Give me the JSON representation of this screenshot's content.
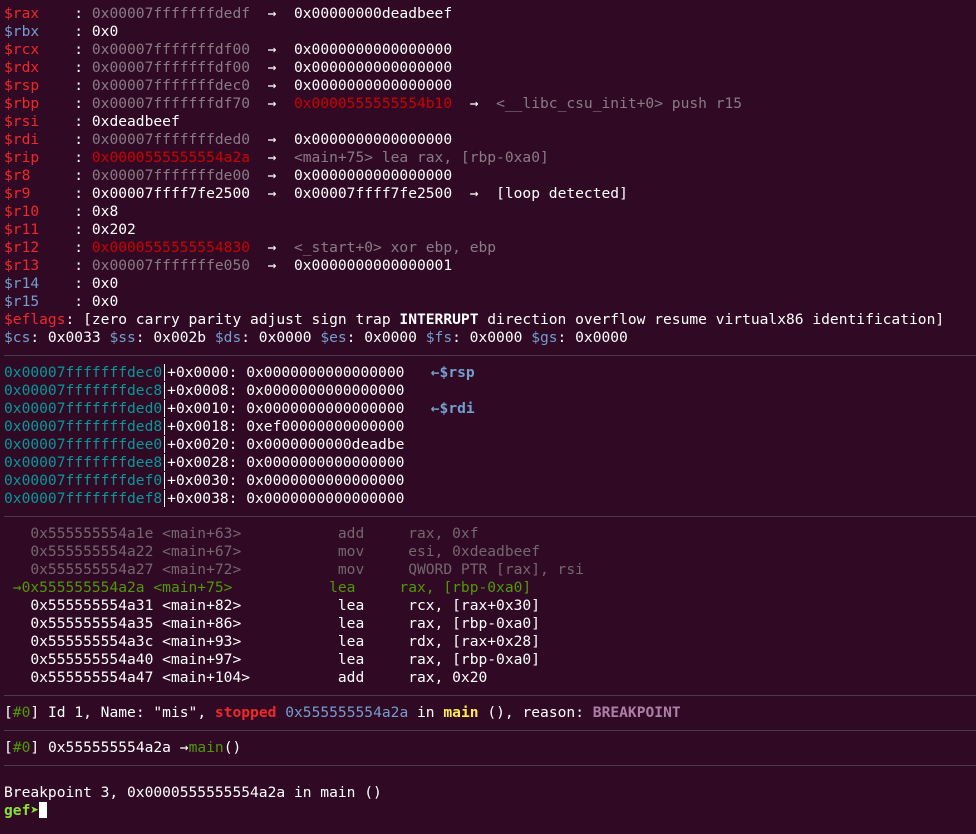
{
  "registers": [
    {
      "name": "$rax",
      "nc": "red",
      "val": "0x00007fffffffdedf",
      "vc": "gray",
      "chain": [
        {
          "t": "0x00000000deadbeef",
          "c": "white"
        }
      ]
    },
    {
      "name": "$rbx",
      "nc": "blue",
      "val": "0x0",
      "vc": "white",
      "chain": []
    },
    {
      "name": "$rcx",
      "nc": "red",
      "val": "0x00007fffffffdf00",
      "vc": "gray",
      "chain": [
        {
          "t": "0x0000000000000000",
          "c": "white"
        }
      ]
    },
    {
      "name": "$rdx",
      "nc": "red",
      "val": "0x00007fffffffdf00",
      "vc": "gray",
      "chain": [
        {
          "t": "0x0000000000000000",
          "c": "white"
        }
      ]
    },
    {
      "name": "$rsp",
      "nc": "red",
      "val": "0x00007fffffffdec0",
      "vc": "gray",
      "chain": [
        {
          "t": "0x0000000000000000",
          "c": "white"
        }
      ]
    },
    {
      "name": "$rbp",
      "nc": "red",
      "val": "0x00007fffffffdf70",
      "vc": "gray",
      "chain": [
        {
          "t": "0x0000555555554b10",
          "c": "dimred"
        },
        {
          "t": "<__libc_csu_init+0> push r15",
          "c": "gray"
        }
      ]
    },
    {
      "name": "$rsi",
      "nc": "red",
      "val": "0xdeadbeef",
      "vc": "white",
      "chain": []
    },
    {
      "name": "$rdi",
      "nc": "red",
      "val": "0x00007fffffffded0",
      "vc": "gray",
      "chain": [
        {
          "t": "0x0000000000000000",
          "c": "white"
        }
      ]
    },
    {
      "name": "$rip",
      "nc": "red",
      "val": "0x0000555555554a2a",
      "vc": "dimred",
      "chain": [
        {
          "t": "<main+75> lea rax, [rbp-0xa0]",
          "c": "gray"
        }
      ]
    },
    {
      "name": "$r8",
      "nc": "red",
      "val": "0x00007fffffffde00",
      "vc": "gray",
      "chain": [
        {
          "t": "0x0000000000000000",
          "c": "white"
        }
      ]
    },
    {
      "name": "$r9",
      "nc": "red",
      "val": "0x00007ffff7fe2500",
      "vc": "white",
      "chain": [
        {
          "t": "0x00007ffff7fe2500",
          "c": "white"
        },
        {
          "t": "[loop detected]",
          "c": "white"
        }
      ]
    },
    {
      "name": "$r10",
      "nc": "red",
      "val": "0x8",
      "vc": "white",
      "chain": []
    },
    {
      "name": "$r11",
      "nc": "red",
      "val": "0x202",
      "vc": "white",
      "chain": []
    },
    {
      "name": "$r12",
      "nc": "red",
      "val": "0x0000555555554830",
      "vc": "dimred",
      "chain": [
        {
          "t": "<_start+0> xor ebp, ebp",
          "c": "gray"
        }
      ]
    },
    {
      "name": "$r13",
      "nc": "red",
      "val": "0x00007fffffffe050",
      "vc": "gray",
      "chain": [
        {
          "t": "0x0000000000000001",
          "c": "white"
        }
      ]
    },
    {
      "name": "$r14",
      "nc": "blue",
      "val": "0x0",
      "vc": "white",
      "chain": []
    },
    {
      "name": "$r15",
      "nc": "blue",
      "val": "0x0",
      "vc": "white",
      "chain": []
    }
  ],
  "arrow": "→",
  "eflags": {
    "label": "$eflags",
    "pre": "[zero carry parity adjust sign trap ",
    "bold": "INTERRUPT",
    "post": " direction overflow resume virtualx86 identification]"
  },
  "segments": [
    {
      "name": "$cs",
      "val": "0x0033"
    },
    {
      "name": "$ss",
      "val": "0x002b"
    },
    {
      "name": "$ds",
      "val": "0x0000"
    },
    {
      "name": "$es",
      "val": "0x0000"
    },
    {
      "name": "$fs",
      "val": "0x0000"
    },
    {
      "name": "$gs",
      "val": "0x0000"
    }
  ],
  "stack": [
    {
      "addr": "0x00007fffffffdec0",
      "off": "+0x0000",
      "val": "0x0000000000000000",
      "tag": "←$rsp"
    },
    {
      "addr": "0x00007fffffffdec8",
      "off": "+0x0008",
      "val": "0x0000000000000000",
      "tag": ""
    },
    {
      "addr": "0x00007fffffffded0",
      "off": "+0x0010",
      "val": "0x0000000000000000",
      "tag": "←$rdi"
    },
    {
      "addr": "0x00007fffffffded8",
      "off": "+0x0018",
      "val": "0xef00000000000000",
      "tag": ""
    },
    {
      "addr": "0x00007fffffffdee0",
      "off": "+0x0020",
      "val": "0x0000000000deadbe",
      "tag": ""
    },
    {
      "addr": "0x00007fffffffdee8",
      "off": "+0x0028",
      "val": "0x0000000000000000",
      "tag": ""
    },
    {
      "addr": "0x00007fffffffdef0",
      "off": "+0x0030",
      "val": "0x0000000000000000",
      "tag": ""
    },
    {
      "addr": "0x00007fffffffdef8",
      "off": "+0x0038",
      "val": "0x0000000000000000",
      "tag": ""
    }
  ],
  "code": [
    {
      "addr": "0x555555554a1e",
      "sym": "<main+63>",
      "op": "add",
      "args": "rax, 0xf",
      "state": "past"
    },
    {
      "addr": "0x555555554a22",
      "sym": "<main+67>",
      "op": "mov",
      "args": "esi, 0xdeadbeef",
      "state": "past"
    },
    {
      "addr": "0x555555554a27",
      "sym": "<main+72>",
      "op": "mov",
      "args": "QWORD PTR [rax], rsi",
      "state": "past"
    },
    {
      "addr": "0x555555554a2a",
      "sym": "<main+75>",
      "op": "lea",
      "args": "rax, [rbp-0xa0]",
      "state": "current"
    },
    {
      "addr": "0x555555554a31",
      "sym": "<main+82>",
      "op": "lea",
      "args": "rcx, [rax+0x30]",
      "state": "future"
    },
    {
      "addr": "0x555555554a35",
      "sym": "<main+86>",
      "op": "lea",
      "args": "rax, [rbp-0xa0]",
      "state": "future"
    },
    {
      "addr": "0x555555554a3c",
      "sym": "<main+93>",
      "op": "lea",
      "args": "rdx, [rax+0x28]",
      "state": "future"
    },
    {
      "addr": "0x555555554a40",
      "sym": "<main+97>",
      "op": "lea",
      "args": "rax, [rbp-0xa0]",
      "state": "future"
    },
    {
      "addr": "0x555555554a47",
      "sym": "<main+104>",
      "op": "add",
      "args": "rax, 0x20",
      "state": "future"
    }
  ],
  "code_arrow": "→",
  "thread": {
    "open": "[",
    "idx": "#0",
    "close": "]",
    "text1": " Id 1, Name: \"mis\", ",
    "stopped": "stopped",
    "addr": "0x555555554a2a",
    "in": " in ",
    "func": "main",
    "text2": " (), reason: ",
    "reason": "BREAKPOINT"
  },
  "trace": {
    "open": "[",
    "idx": "#0",
    "close": "]",
    "addr": " 0x555555554a2a ",
    "arrow": "→",
    "func": "main",
    "parens": "()"
  },
  "breakpoint_msg": "Breakpoint 3, 0x0000555555554a2a in main ()",
  "prompt": "gef",
  "prompt_arrow": "➤"
}
